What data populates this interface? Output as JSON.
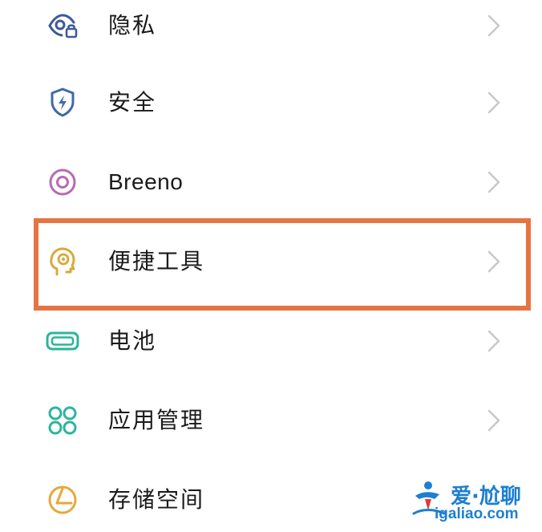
{
  "settings_list": {
    "items": [
      {
        "label": "隐私",
        "icon": "privacy-eye-lock-icon"
      },
      {
        "label": "安全",
        "icon": "security-shield-icon"
      },
      {
        "label": "Breeno",
        "icon": "breeno-ring-icon"
      },
      {
        "label": "便捷工具",
        "icon": "convenience-tools-head-icon"
      },
      {
        "label": "电池",
        "icon": "battery-icon"
      },
      {
        "label": "应用管理",
        "icon": "app-management-grid-icon"
      },
      {
        "label": "存储空间",
        "icon": "storage-pie-icon"
      }
    ],
    "highlighted_item": "便捷工具"
  },
  "watermark": {
    "text": "爱·尬聊",
    "url": "igaliao.com"
  },
  "colors": {
    "highlight_border": "#e57443",
    "privacy_icon": "#3d5a9a",
    "security_icon": "#3f6aa8",
    "breeno_icon": "#b76bb1",
    "tools_icon": "#d9a93a",
    "battery_icon": "#2bb59b",
    "apps_icon": "#2bb59b",
    "storage_icon": "#e7a83a",
    "chevron": "#c8c8c8",
    "watermark": "#1d7fd0"
  }
}
